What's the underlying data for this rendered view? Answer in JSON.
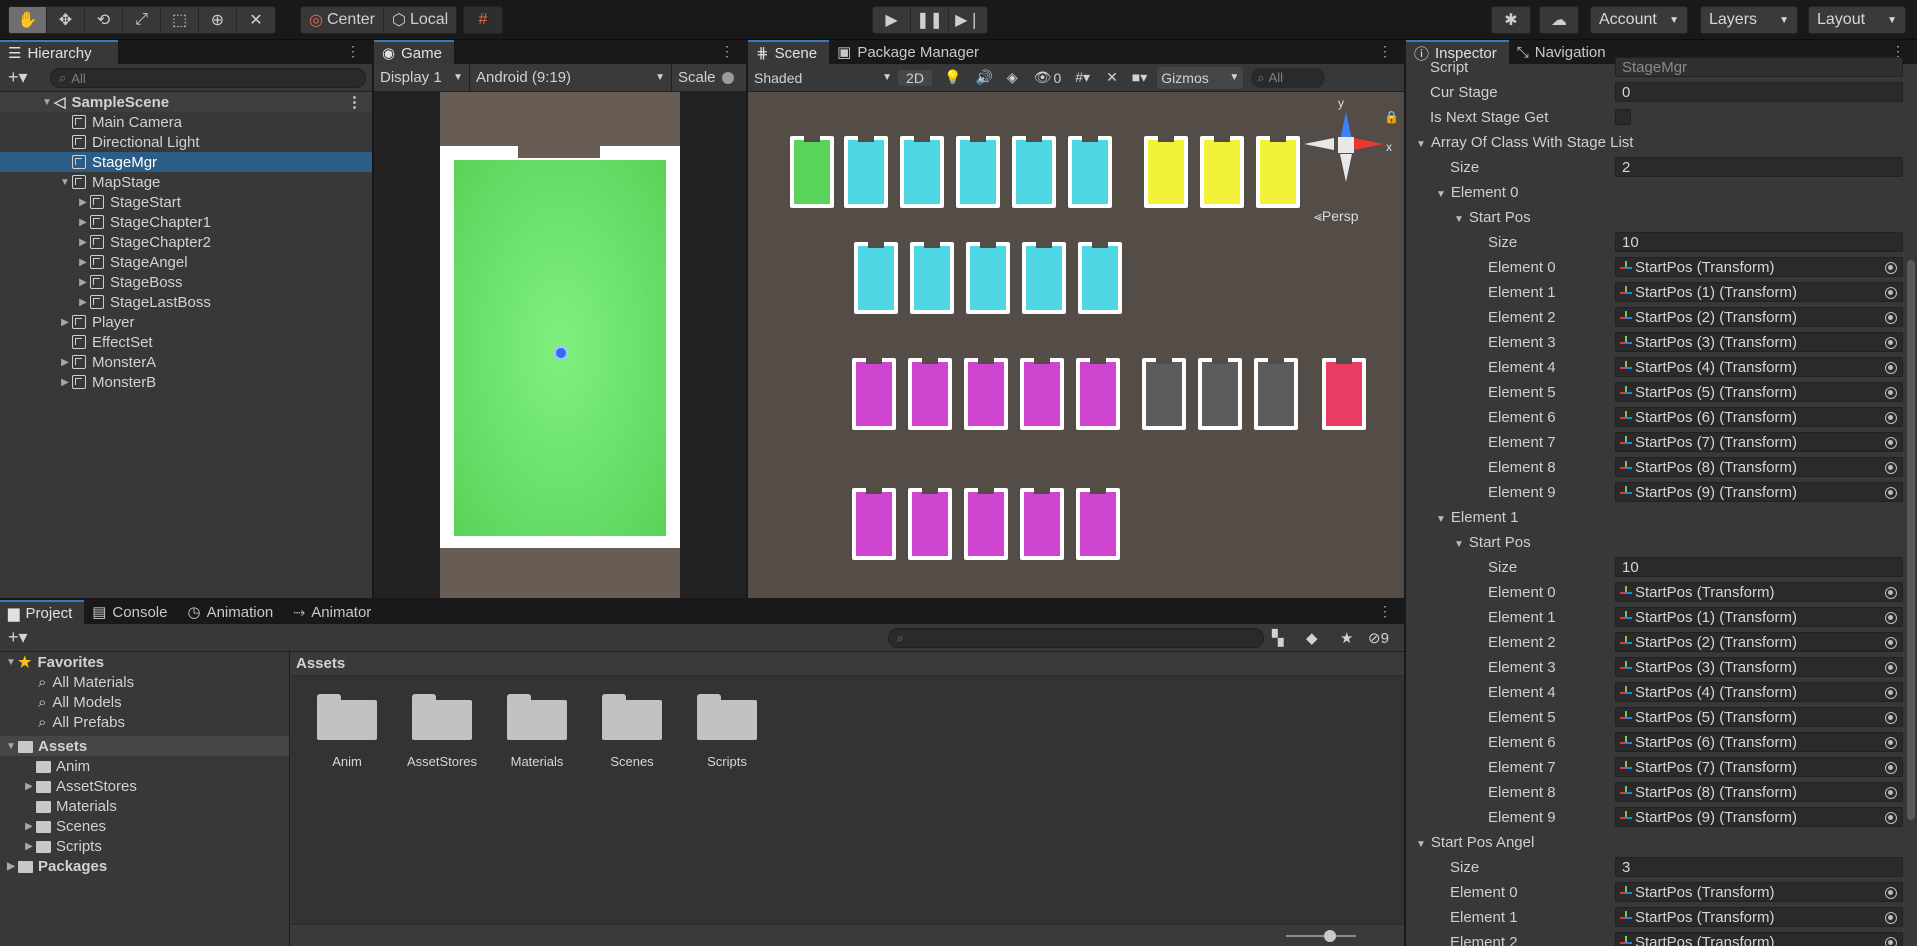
{
  "toolbar": {
    "pivot": "Center",
    "space": "Local",
    "account": "Account",
    "layers": "Layers",
    "layout": "Layout"
  },
  "hierarchy": {
    "tab": "Hierarchy",
    "search_placeholder": "All",
    "scene": "SampleScene",
    "items": [
      {
        "label": "Main Camera",
        "depth": 1,
        "arrow": false
      },
      {
        "label": "Directional Light",
        "depth": 1,
        "arrow": false
      },
      {
        "label": "StageMgr",
        "depth": 1,
        "arrow": false,
        "selected": true
      },
      {
        "label": "MapStage",
        "depth": 1,
        "arrow": "open"
      },
      {
        "label": "StageStart",
        "depth": 2,
        "arrow": "closed"
      },
      {
        "label": "StageChapter1",
        "depth": 2,
        "arrow": "closed"
      },
      {
        "label": "StageChapter2",
        "depth": 2,
        "arrow": "closed"
      },
      {
        "label": "StageAngel",
        "depth": 2,
        "arrow": "closed"
      },
      {
        "label": "StageBoss",
        "depth": 2,
        "arrow": "closed"
      },
      {
        "label": "StageLastBoss",
        "depth": 2,
        "arrow": "closed"
      },
      {
        "label": "Player",
        "depth": 1,
        "arrow": "closed"
      },
      {
        "label": "EffectSet",
        "depth": 1,
        "arrow": false
      },
      {
        "label": "MonsterA",
        "depth": 1,
        "arrow": "closed"
      },
      {
        "label": "MonsterB",
        "depth": 1,
        "arrow": "closed"
      }
    ]
  },
  "game": {
    "tab": "Game",
    "display": "Display 1",
    "aspect": "Android (9:19)",
    "scale": "Scale"
  },
  "scene": {
    "tabs": [
      "Scene",
      "Package Manager"
    ],
    "shading": "Shaded",
    "mode2d": "2D",
    "hidden_count": "0",
    "gizmos": "Gizmos",
    "search_placeholder": "All",
    "persp": "Persp",
    "axis_y": "y",
    "axis_x": "x"
  },
  "project": {
    "tabs": [
      "Project",
      "Console",
      "Animation",
      "Animator"
    ],
    "hidden_count": "9",
    "favorites_label": "Favorites",
    "favorites": [
      "All Materials",
      "All Models",
      "All Prefabs"
    ],
    "assets_label": "Assets",
    "asset_folders": [
      {
        "label": "Anim",
        "arrow": false
      },
      {
        "label": "AssetStores",
        "arrow": true
      },
      {
        "label": "Materials",
        "arrow": false
      },
      {
        "label": "Scenes",
        "arrow": true
      },
      {
        "label": "Scripts",
        "arrow": true
      }
    ],
    "packages_label": "Packages",
    "breadcrumb": "Assets",
    "grid": [
      "Anim",
      "AssetStores",
      "Materials",
      "Scenes",
      "Scripts"
    ]
  },
  "inspector": {
    "tabs": [
      "Inspector",
      "Navigation"
    ],
    "script_label": "Script",
    "script_value": "StageMgr",
    "cur_stage_label": "Cur Stage",
    "cur_stage_value": "0",
    "next_stage_label": "Is Next Stage Get",
    "array_label": "Array Of Class With Stage List",
    "size_label": "Size",
    "array_size": "2",
    "element_labels": [
      "Element 0",
      "Element 1",
      "Element 2",
      "Element 3",
      "Element 4",
      "Element 5",
      "Element 6",
      "Element 7",
      "Element 8",
      "Element 9"
    ],
    "start_pos_label": "Start Pos",
    "start_pos_size": "10",
    "start_pos_values": [
      "StartPos (Transform)",
      "StartPos (1) (Transform)",
      "StartPos (2) (Transform)",
      "StartPos (3) (Transform)",
      "StartPos (4) (Transform)",
      "StartPos (5) (Transform)",
      "StartPos (6) (Transform)",
      "StartPos (7) (Transform)",
      "StartPos (8) (Transform)",
      "StartPos (9) (Transform)"
    ],
    "angel_label": "Start Pos Angel",
    "angel_size": "3",
    "angel_values": [
      "StartPos (Transform)",
      "StartPos (Transform)",
      "StartPos (Transform)"
    ]
  },
  "colors": {
    "accent": "#3a79bb",
    "selection": "#2c5d87",
    "stage_green": "#5ad35a",
    "stage_cyan": "#4fd6e3",
    "stage_yellow": "#f2f23a",
    "stage_magenta": "#cf45cf",
    "stage_gray": "#5c5c5c",
    "stage_red": "#ea3c63"
  }
}
